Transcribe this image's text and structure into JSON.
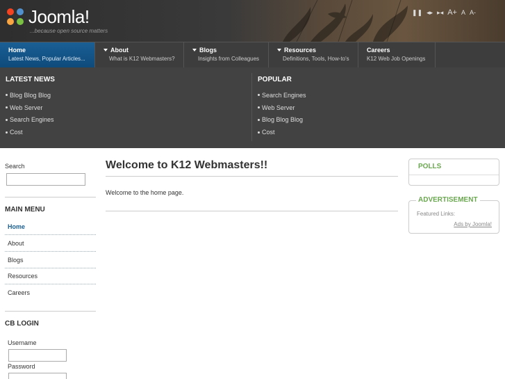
{
  "header": {
    "logo_text": "Joomla!",
    "tagline": "...because open source matters",
    "controls": [
      "❚❚",
      "◂▸",
      "▸◂",
      "A+",
      "A",
      "A-"
    ]
  },
  "nav": [
    {
      "title": "Home",
      "subtitle": "Latest News, Popular Articles...",
      "active": true,
      "has_caret": false
    },
    {
      "title": "About",
      "subtitle": "What is K12 Webmasters?",
      "active": false,
      "has_caret": true
    },
    {
      "title": "Blogs",
      "subtitle": "Insights from Colleagues",
      "active": false,
      "has_caret": true
    },
    {
      "title": "Resources",
      "subtitle": "Definitions, Tools, How-to's",
      "active": false,
      "has_caret": true
    },
    {
      "title": "Careers",
      "subtitle": "K12 Web Job Openings",
      "active": false,
      "has_caret": false
    }
  ],
  "showcase": {
    "latest": {
      "title": "LATEST NEWS",
      "items": [
        "Blog Blog Blog",
        "Web Server",
        "Search Engines",
        "Cost"
      ]
    },
    "popular": {
      "title": "POPULAR",
      "items": [
        "Search Engines",
        "Web Server",
        "Blog Blog Blog",
        "Cost"
      ]
    }
  },
  "sidebar": {
    "search_label": "Search",
    "search_value": "",
    "main_menu_title": "MAIN MENU",
    "menu_items": [
      "Home",
      "About",
      "Blogs",
      "Resources",
      "Careers"
    ],
    "login_title": "CB LOGIN",
    "username_label": "Username",
    "password_label": "Password"
  },
  "content": {
    "heading": "Welcome to K12 Webmasters!!",
    "body": "Welcome to the home page."
  },
  "right": {
    "polls_title": "POLLS",
    "ad_title": "ADVERTISEMENT",
    "featured_links": "Featured Links:",
    "ads_link": "Ads by Joomla!"
  },
  "colors": {
    "accent_blue": "#1a5f95",
    "module_green": "#6aa84f",
    "nav_bg": "#3d3d3d",
    "band_bg": "#424242"
  }
}
